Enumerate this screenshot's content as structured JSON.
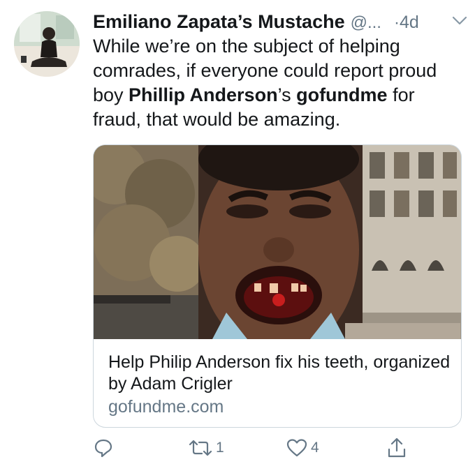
{
  "tweet": {
    "display_name": "Emiliano Zapata’s Mustache",
    "handle": "@...",
    "separator": "·",
    "time": "4d",
    "text": {
      "p1": "While we’re on the subject of helping comrades, if everyone could report proud boy ",
      "b1": "Phillip Anderson",
      "p2": "’s ",
      "b2": "gofundme",
      "p3": " for fraud, that would be amazing."
    },
    "card": {
      "title": "Help Philip Anderson fix his teeth, organized by Adam Crigler",
      "domain": "gofundme.com"
    },
    "actions": {
      "retweet_count": "1",
      "like_count": "4"
    }
  },
  "icons": {
    "avatar": "profile-photo",
    "more": "chevron-down-icon",
    "reply": "reply-icon",
    "retweet": "retweet-icon",
    "like": "heart-icon",
    "share": "share-icon"
  },
  "colors": {
    "text": "#14171a",
    "secondary": "#657786",
    "border": "#ccd6dd"
  }
}
